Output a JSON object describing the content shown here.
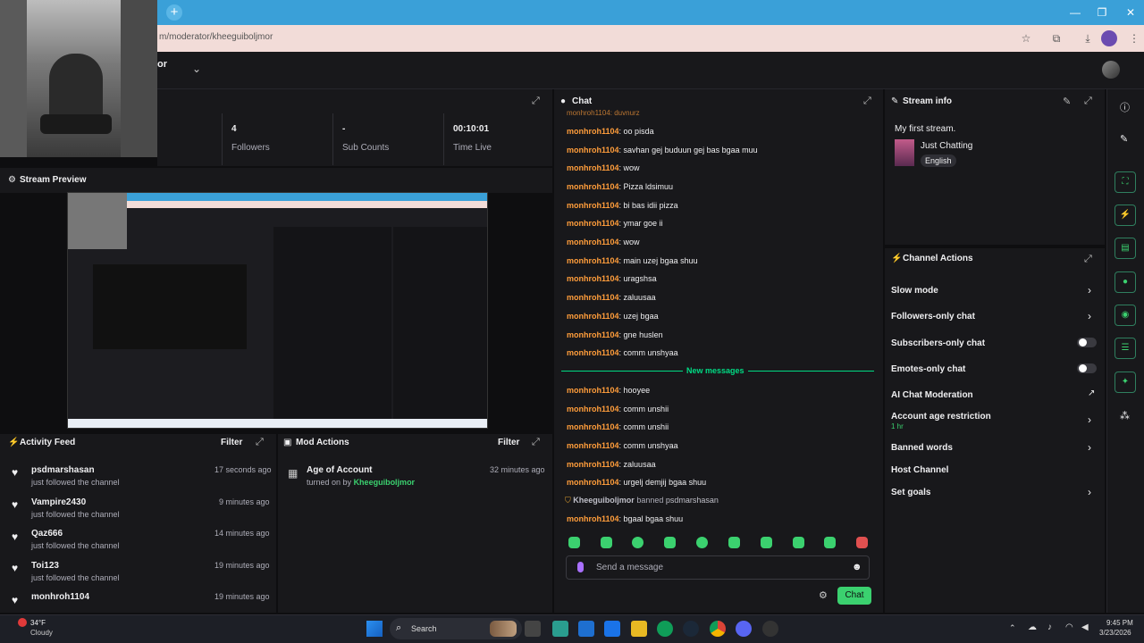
{
  "browser": {
    "url": "m/moderator/kheeguiboljmor"
  },
  "header": {
    "title_fragment": "or"
  },
  "stats": [
    {
      "value": "4",
      "label": "Followers"
    },
    {
      "value": "-",
      "label": "Sub Counts"
    },
    {
      "value": "00:10:01",
      "label": "Time Live"
    }
  ],
  "preview": {
    "title": "Stream Preview"
  },
  "activity": {
    "title": "Activity Feed",
    "filter": "Filter",
    "items": [
      {
        "name": "psdmarshasan",
        "sub": "just followed the channel",
        "time": "17 seconds ago"
      },
      {
        "name": "Vampire2430",
        "sub": "just followed the channel",
        "time": "9 minutes ago"
      },
      {
        "name": "Qaz666",
        "sub": "just followed the channel",
        "time": "14 minutes ago"
      },
      {
        "name": "Toi123",
        "sub": "just followed the channel",
        "time": "19 minutes ago"
      },
      {
        "name": "monhroh1104",
        "sub": "",
        "time": "19 minutes ago"
      }
    ]
  },
  "mod_actions": {
    "title": "Mod Actions",
    "filter": "Filter",
    "items": [
      {
        "title": "Age of Account",
        "sub": "turned on by",
        "user": "Kheeguiboljmor",
        "time": "32 minutes ago"
      }
    ]
  },
  "chat": {
    "title": "Chat",
    "top_fragment": "monhroh1104: duvnurz",
    "messages": [
      {
        "user": "monhroh1104",
        "text": "oo pisda"
      },
      {
        "user": "monhroh1104",
        "text": "savhan gej buduun gej bas bgaa muu"
      },
      {
        "user": "monhroh1104",
        "text": "wow"
      },
      {
        "user": "monhroh1104",
        "text": "Pizza ldsimuu"
      },
      {
        "user": "monhroh1104",
        "text": "bi bas idii pizza"
      },
      {
        "user": "monhroh1104",
        "text": "ymar goe ii"
      },
      {
        "user": "monhroh1104",
        "text": "wow"
      },
      {
        "user": "monhroh1104",
        "text": "main uzej bgaa shuu"
      },
      {
        "user": "monhroh1104",
        "text": "uragshsa"
      },
      {
        "user": "monhroh1104",
        "text": "zaluusaa"
      },
      {
        "user": "monhroh1104",
        "text": "uzej bgaa"
      },
      {
        "user": "monhroh1104",
        "text": "gne huslen"
      },
      {
        "user": "monhroh1104",
        "text": "comm unshyaa"
      }
    ],
    "new_messages_label": "New messages",
    "new_messages": [
      {
        "user": "monhroh1104",
        "text": "hooyee"
      },
      {
        "user": "monhroh1104",
        "text": "comm unshii"
      },
      {
        "user": "monhroh1104",
        "text": "comm unshii"
      },
      {
        "user": "monhroh1104",
        "text": "comm unshyaa"
      },
      {
        "user": "monhroh1104",
        "text": "zaluusaa"
      },
      {
        "user": "monhroh1104",
        "text": "urgelj demjij bgaa shuu"
      }
    ],
    "ban": {
      "mod": "Kheeguiboljmor",
      "verb": "banned",
      "target": "psdmarshasan"
    },
    "last_message": {
      "user": "monhroh1104",
      "text": "bgaal bgaa shuu"
    },
    "input_placeholder": "Send a message",
    "send_label": "Chat"
  },
  "stream_info": {
    "title": "Stream info",
    "stream_title": "My first stream.",
    "category": "Just Chatting",
    "language": "English"
  },
  "channel_actions": {
    "title": "Channel Actions",
    "items": [
      {
        "label": "Slow mode",
        "control": "chevron",
        "sub": ""
      },
      {
        "label": "Followers-only chat",
        "control": "chevron",
        "sub": ""
      },
      {
        "label": "Subscribers-only chat",
        "control": "toggle",
        "sub": ""
      },
      {
        "label": "Emotes-only chat",
        "control": "toggle",
        "sub": ""
      },
      {
        "label": "AI Chat Moderation",
        "control": "external",
        "sub": ""
      },
      {
        "label": "Account age restriction",
        "control": "chevron",
        "sub": "1 hr"
      },
      {
        "label": "Banned words",
        "control": "chevron",
        "sub": ""
      },
      {
        "label": "Host Channel",
        "control": "none",
        "sub": ""
      },
      {
        "label": "Set goals",
        "control": "chevron",
        "sub": ""
      }
    ]
  },
  "taskbar": {
    "weather_temp": "34°F",
    "weather_desc": "Cloudy",
    "search_label": "Search",
    "time": "9:45 PM",
    "date": "3/23/2026"
  },
  "colors": {
    "accent": "#3bd16f",
    "username": "#ff9d3b",
    "new_messages": "#00db84",
    "browser_titlebar": "#3aa0d8"
  }
}
